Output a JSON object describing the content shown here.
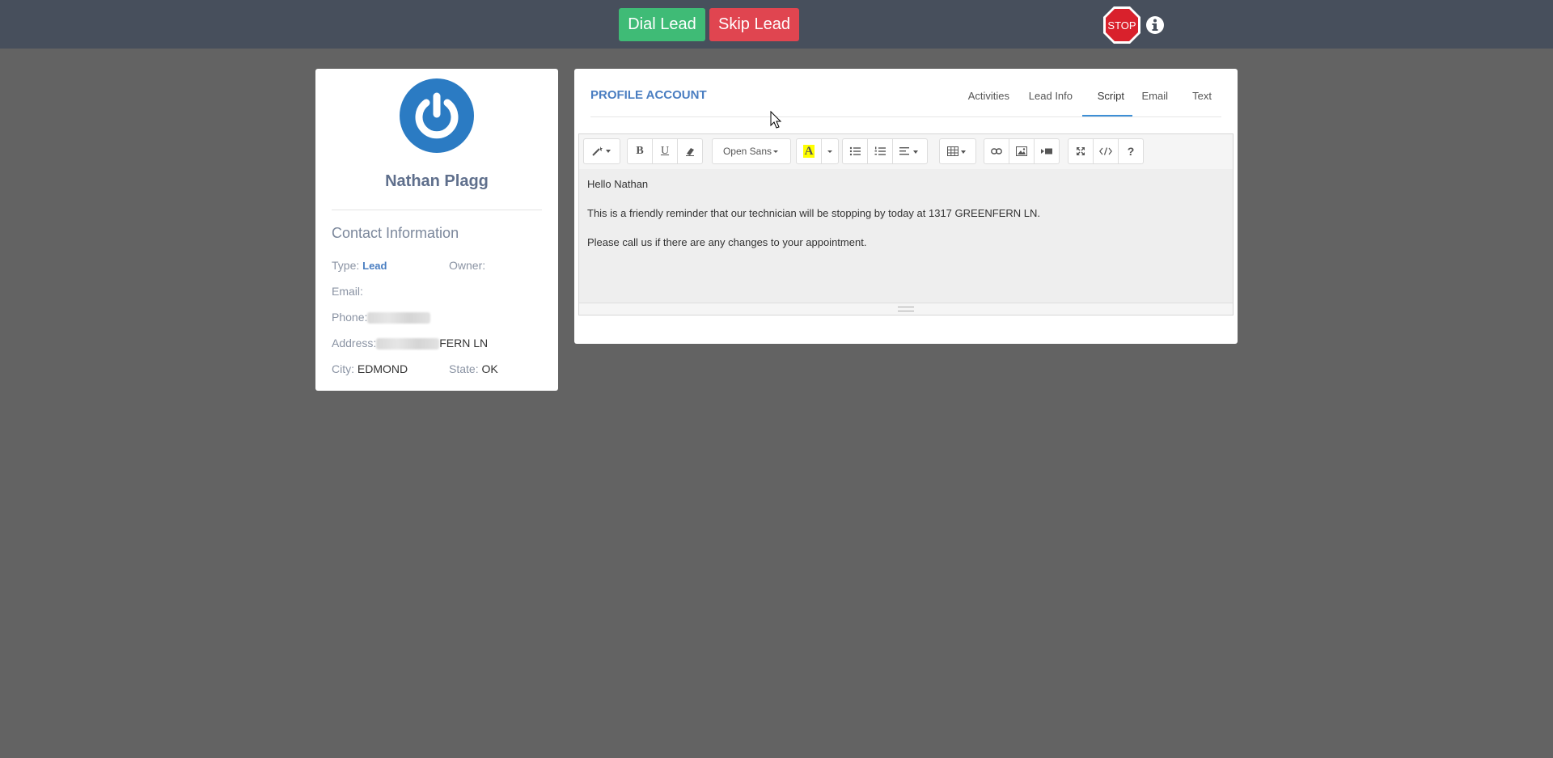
{
  "topbar": {
    "dial_label": "Dial Lead",
    "skip_label": "Skip Lead",
    "stop_label": "STOP",
    "info_icon": "info-circle-icon"
  },
  "colors": {
    "dial": "#3fbb76",
    "skip": "#e04550",
    "accent": "#4a7ec1",
    "topbar": "#474f5c",
    "background": "#636363"
  },
  "lead": {
    "name": "Nathan Plagg",
    "contact_title": "Contact Information",
    "fields": {
      "type_label": "Type:",
      "type_value": "Lead",
      "owner_label": "Owner:",
      "email_label": "Email:",
      "phone_label": "Phone:",
      "address_label": "Address:",
      "address_value": "FERN LN",
      "city_label": "City:",
      "city_value": "EDMOND",
      "state_label": "State:",
      "state_value": "OK"
    }
  },
  "profile": {
    "title": "PROFILE ACCOUNT",
    "tabs": {
      "activities": "Activities",
      "lead_info": "Lead Info",
      "script": "Script",
      "email": "Email",
      "text": "Text"
    },
    "active_tab": "Script"
  },
  "editor": {
    "font_name": "Open Sans",
    "lines": [
      "Hello Nathan",
      "This is a friendly reminder that our technician will be stopping by today at 1317 GREENFERN LN.",
      "Please call us if there are any changes to your appointment."
    ]
  }
}
